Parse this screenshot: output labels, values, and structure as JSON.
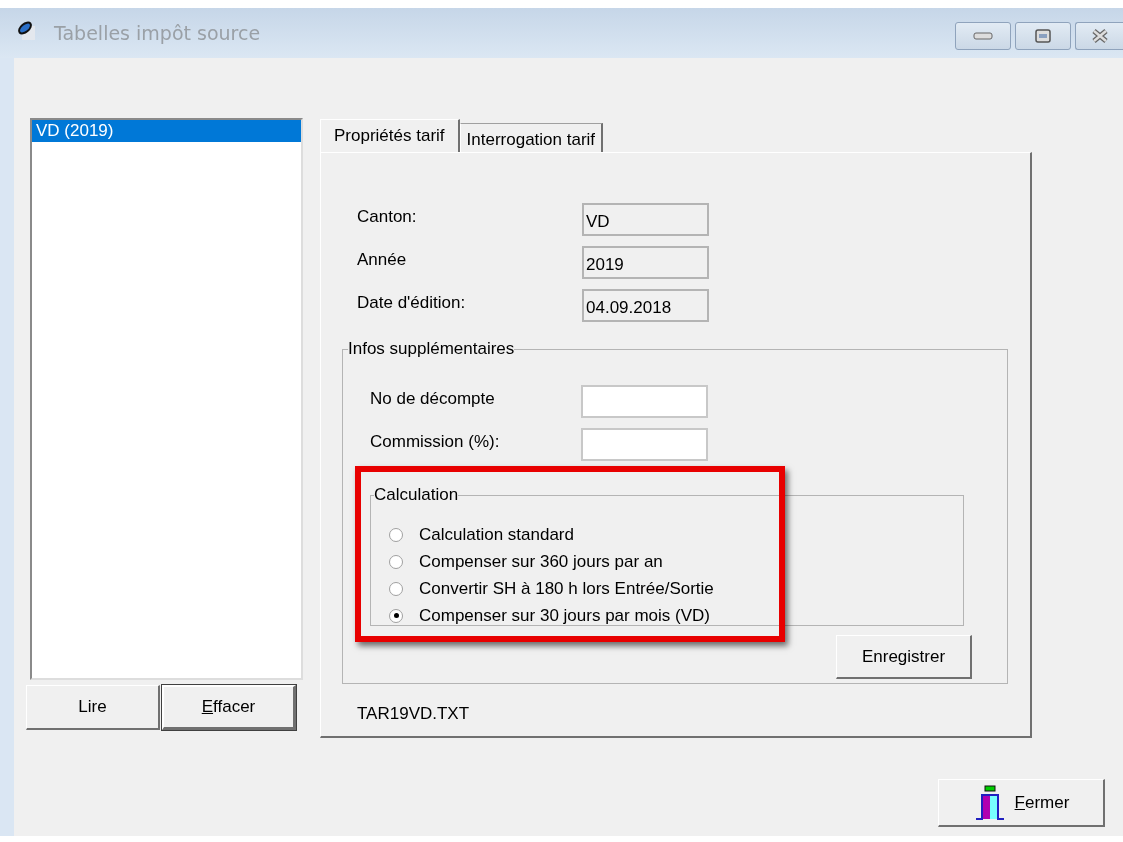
{
  "window": {
    "title": "Tabelles impôt source"
  },
  "list": {
    "items": [
      {
        "label": "VD (2019)",
        "selected": true
      }
    ]
  },
  "list_buttons": [
    {
      "label": "Lire",
      "default": false,
      "underline_first": false
    },
    {
      "label": "Effacer",
      "default": true,
      "underline_first": true
    }
  ],
  "tabs": [
    {
      "label": "Propriétés tarif",
      "selected": true
    },
    {
      "label": "Interrogation tarif",
      "selected": false
    }
  ],
  "fields": [
    {
      "label": "Canton:",
      "value": "VD",
      "readonly": true
    },
    {
      "label": "Année",
      "value": "2019",
      "readonly": true
    },
    {
      "label": "Date d'édition:",
      "value": "04.09.2018",
      "readonly": true
    }
  ],
  "infos": {
    "title": "Infos supplémentaires",
    "fields": [
      {
        "label": "No de décompte",
        "readonly": false
      },
      {
        "label": "Commission (%):",
        "readonly": false
      }
    ],
    "calculation": {
      "title": "Calculation",
      "options": [
        {
          "label": "Calculation standard",
          "selected": false
        },
        {
          "label": "Compenser sur 360 jours par an",
          "selected": false
        },
        {
          "label": "Convertir SH à 180 h lors Entrée/Sortie",
          "selected": false
        },
        {
          "label": "Compenser sur 30 jours par mois (VD)",
          "selected": true
        }
      ]
    },
    "save_button": "Enregistrer"
  },
  "file_name": "TAR19VD.TXT",
  "close_button": {
    "label": "Fermer",
    "underline_first": true
  },
  "annotation": {
    "kind": "rectangle"
  }
}
